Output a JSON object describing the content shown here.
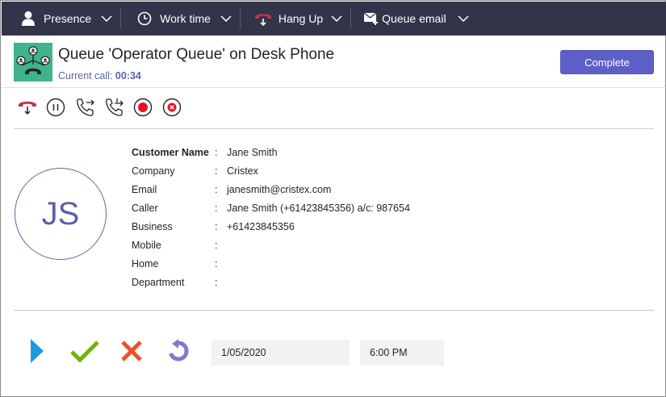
{
  "toolbar": {
    "items": [
      {
        "label": "Presence",
        "icon": "person-icon"
      },
      {
        "label": "Work time",
        "icon": "clock-icon"
      },
      {
        "label": "Hang Up",
        "icon": "hang-up-icon"
      },
      {
        "label": "Queue email",
        "icon": "email-add-icon"
      }
    ]
  },
  "header": {
    "title": "Queue 'Operator Queue' on Desk Phone",
    "current_call_label": "Current call:",
    "current_call_time": "00:34",
    "complete_label": "Complete"
  },
  "call_actions": [
    "hang-up-icon",
    "pause-icon",
    "transfer-icon",
    "consult-transfer-icon",
    "record-icon",
    "stop-icon"
  ],
  "customer": {
    "initials": "JS",
    "fields": [
      {
        "label": "Customer Name",
        "value": "Jane Smith"
      },
      {
        "label": "Company",
        "value": "Cristex"
      },
      {
        "label": "Email",
        "value": "janesmith@cristex.com"
      },
      {
        "label": "Caller",
        "value": "Jane Smith (+61423845356) a/c: 987654"
      },
      {
        "label": "Business",
        "value": "+61423845356"
      },
      {
        "label": "Mobile",
        "value": ""
      },
      {
        "label": "Home",
        "value": ""
      },
      {
        "label": "Department",
        "value": ""
      }
    ],
    "separator": ":"
  },
  "bottom": {
    "date": "1/05/2020",
    "time": "6:00 PM"
  },
  "colors": {
    "toolbar_bg": "#33344a",
    "accent": "#5b5fc7",
    "avatar_bg": "#3fb48a",
    "hangup_red": "#c4314b",
    "play_blue": "#1b9ae0",
    "check_green": "#6bb700",
    "cross_orange": "#e8532c",
    "redo_purple": "#8b76c9"
  }
}
